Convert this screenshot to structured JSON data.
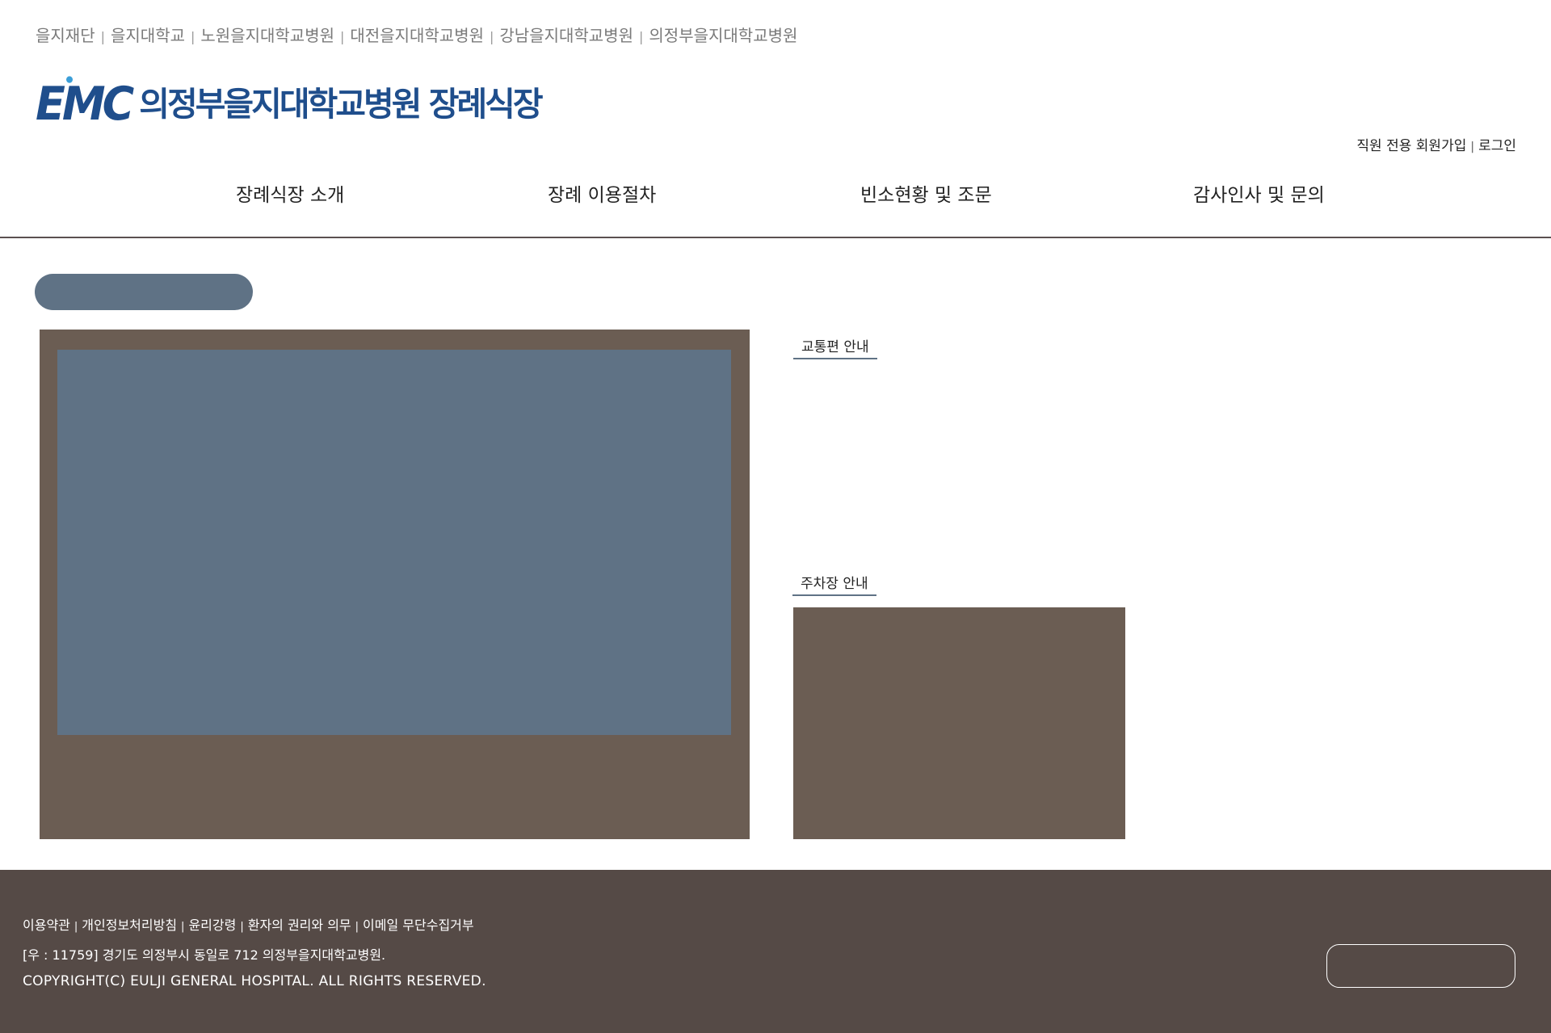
{
  "family_sites": [
    "을지재단",
    "을지대학교",
    "노원을지대학교병원",
    "대전을지대학교병원",
    "강남을지대학교병원",
    "의정부을지대학교병원"
  ],
  "logo": {
    "mark": "EMC",
    "text": "의정부을지대학교병원 장례식장"
  },
  "member_links": [
    "직원 전용 회원가입",
    "로그인"
  ],
  "gnb": [
    "장례식장 소개",
    "장례 이용절차",
    "빈소현황 및 조문",
    "감사인사 및 문의"
  ],
  "sections": {
    "traffic": "교통편 안내",
    "parking": "주차장 안내"
  },
  "footer": {
    "links": [
      "이용약관",
      "개인정보처리방침",
      "윤리강령",
      "환자의 권리와 의무",
      "이메일 무단수집거부"
    ],
    "address": "[우 : 11759] 경기도 의정부시 동일로 712 의정부을지대학교병원.",
    "copyright": "COPYRIGHT(C) EULJI GENERAL HOSPITAL. ALL RIGHTS RESERVED."
  },
  "colors": {
    "brand": "#1f4e8c",
    "slate": "#5f7285",
    "brown": "#6b5d53",
    "footer": "#554a46"
  }
}
